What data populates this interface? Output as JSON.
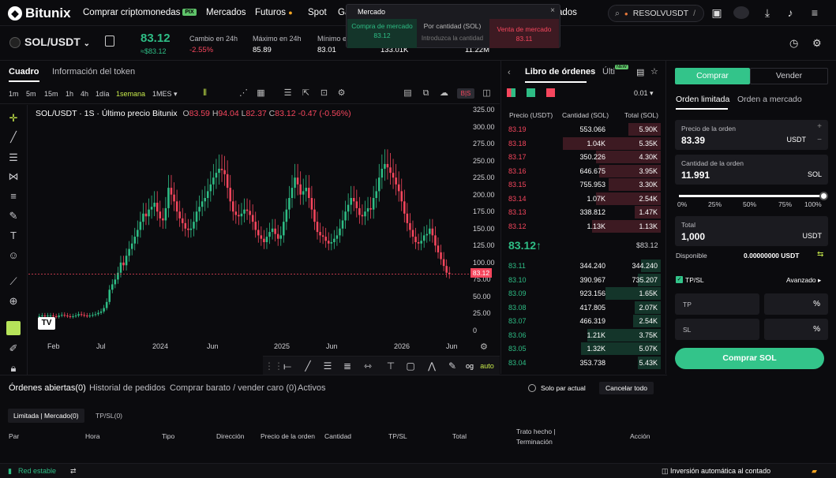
{
  "nav": {
    "brand": "Bitunix",
    "items": [
      {
        "label": "Comprar criptomonedas",
        "badge": "PIX"
      },
      {
        "label": "Mercados"
      },
      {
        "label": "Futuros"
      },
      {
        "label": "Spot"
      },
      {
        "label": "Ga"
      },
      {
        "label": "ados"
      }
    ],
    "search_value": "RESOLVUSDT",
    "search_suffix": "/"
  },
  "popup": {
    "title": "Mercado",
    "close": "×",
    "buy_label": "Compra de mercado",
    "buy_value": "83.12",
    "qty_label": "Por cantidad (SOL)",
    "qty_placeholder": "Introduzca la cantidad",
    "sell_label": "Venta de mercado",
    "sell_value": "83.11"
  },
  "ticker": {
    "pair": "SOL/USDT",
    "price": "83.12",
    "price_fiat": "≈$83.12",
    "change_label": "Cambio en 24h",
    "change_value": "-2.55%",
    "high_label": "Máximo en 24h",
    "high_value": "85.89",
    "low_label": "Mínimo e",
    "low_value": "83.01",
    "vol1_value": "133.01K",
    "vol2_value": "11.22M"
  },
  "chart_tabs": {
    "active": "Cuadro",
    "other": "Información del token"
  },
  "timeframes": [
    "1m",
    "5m",
    "15m",
    "1h",
    "4h",
    "1día",
    "1semana",
    "1MES"
  ],
  "active_timeframe": "1semana",
  "chart_legend": {
    "title": "SOL/USDT · 1S · Último precio Bitunix",
    "o_label": "O",
    "o": "83.59",
    "h_label": "H",
    "h": "94.04",
    "l_label": "L",
    "l": "82.37",
    "c_label": "C",
    "c": "83.12",
    "chg": "-0.47 (-0.56%)"
  },
  "chart_data": {
    "type": "candlestick",
    "y_ticks": [
      "325.00",
      "300.00",
      "275.00",
      "250.00",
      "225.00",
      "200.00",
      "175.00",
      "150.00",
      "125.00",
      "100.00",
      "75.00",
      "50.00",
      "25.00",
      "0"
    ],
    "x_ticks": [
      "Feb",
      "Jul",
      "2024",
      "Jun",
      "2025",
      "Jun",
      "2026",
      "Jun"
    ],
    "ylim": [
      0,
      325
    ],
    "last_price": "83.12",
    "close_series": [
      21,
      22,
      21,
      22,
      22,
      21,
      20,
      22,
      23,
      22,
      21,
      20,
      21,
      22,
      24,
      23,
      22,
      21,
      22,
      23,
      24,
      26,
      28,
      33,
      42,
      60,
      68,
      75,
      85,
      100,
      96,
      110,
      120,
      128,
      138,
      148,
      160,
      172,
      168,
      178,
      182,
      188,
      175,
      165,
      162,
      180,
      210,
      200,
      190,
      175,
      165,
      158,
      150,
      148,
      150,
      160,
      175,
      182,
      190,
      195,
      205,
      215,
      225,
      232,
      238,
      236,
      230,
      210,
      190,
      175,
      170,
      168,
      172,
      178,
      176,
      170,
      160,
      148,
      140,
      135,
      130,
      138,
      145,
      150,
      142,
      135,
      140,
      160,
      178,
      195,
      210,
      225,
      215,
      200,
      205,
      210,
      195,
      178,
      160,
      145,
      140,
      138,
      132,
      128,
      130,
      135,
      140,
      150,
      162,
      175,
      185,
      195,
      190,
      180,
      170,
      168,
      175,
      180,
      178,
      195,
      205,
      225,
      238,
      245,
      240,
      232,
      225,
      215,
      205,
      190,
      172,
      158,
      148,
      138,
      130,
      128,
      132,
      140,
      142,
      150,
      140,
      125,
      115,
      105,
      95,
      85,
      83
    ]
  },
  "orderbook": {
    "tab_active": "Libro de órdenes",
    "tab_other": "Últi",
    "tab_badge": "NEW",
    "precision": "0.01",
    "headers": [
      "Precio (USDT)",
      "Cantidad (SOL)",
      "Total (SOL)"
    ],
    "asks": [
      {
        "p": "83.19",
        "q": "553.066",
        "t": "5.90K",
        "d": 0.2
      },
      {
        "p": "83.18",
        "q": "1.04K",
        "t": "5.35K",
        "d": 0.38
      },
      {
        "p": "83.17",
        "q": "350.226",
        "t": "4.30K",
        "d": 0.13
      },
      {
        "p": "83.16",
        "q": "646.675",
        "t": "3.95K",
        "d": 0.24
      },
      {
        "p": "83.15",
        "q": "755.953",
        "t": "3.30K",
        "d": 0.28
      },
      {
        "p": "83.14",
        "q": "1.07K",
        "t": "2.54K",
        "d": 0.4
      },
      {
        "p": "83.13",
        "q": "338.812",
        "t": "1.47K",
        "d": 0.13
      },
      {
        "p": "83.12",
        "q": "1.13K",
        "t": "1.13K",
        "d": 0.42
      }
    ],
    "mid_price": "83.12",
    "mid_arrow": "↑",
    "mid_fiat": "$83.12",
    "bids": [
      {
        "p": "83.11",
        "q": "344.240",
        "t": "344.240",
        "d": 0.12
      },
      {
        "p": "83.10",
        "q": "390.967",
        "t": "735.207",
        "d": 0.14
      },
      {
        "p": "83.09",
        "q": "923.156",
        "t": "1.65K",
        "d": 0.34
      },
      {
        "p": "83.08",
        "q": "417.805",
        "t": "2.07K",
        "d": 0.15
      },
      {
        "p": "83.07",
        "q": "466.319",
        "t": "2.54K",
        "d": 0.17
      },
      {
        "p": "83.06",
        "q": "1.21K",
        "t": "3.75K",
        "d": 0.45
      },
      {
        "p": "83.05",
        "q": "1.32K",
        "t": "5.07K",
        "d": 0.49
      },
      {
        "p": "83.04",
        "q": "353.738",
        "t": "5.43K",
        "d": 0.13
      }
    ]
  },
  "trade": {
    "buy_tab": "Comprar",
    "sell_tab": "Vender",
    "type_active": "Orden limitada",
    "type_other": "Orden a mercado",
    "price_label": "Precio de la orden",
    "price_value": "83.39",
    "price_unit": "USDT",
    "qty_label": "Cantidad de la orden",
    "qty_value": "11.991",
    "qty_unit": "SOL",
    "slider_pct": 1.0,
    "slider_marks": [
      "0%",
      "25%",
      "50%",
      "75%",
      "100%"
    ],
    "total_label": "Total",
    "total_value": "1,000",
    "total_unit": "USDT",
    "available_label": "Disponible",
    "available_value": "0.00000000 USDT",
    "tpsl_label": "TP/SL",
    "advanced": "Avanzado",
    "tp_label": "TP",
    "sl_label": "SL",
    "pct": "%",
    "submit": "Comprar SOL"
  },
  "orders": {
    "tabs": [
      "Órdenes abiertas(0)",
      "Historial de pedidos",
      "Comprar barato / vender caro (0)",
      "Activos"
    ],
    "only_current": "Solo par actual",
    "cancel_all": "Cancelar todo",
    "subtabs": [
      "Limitada | Mercado(0)",
      "TP/SL(0)"
    ],
    "columns": [
      "Par",
      "Hora",
      "Tipo",
      "Dirección",
      "Precio de la orden",
      "Cantidad",
      "TP/SL",
      "Total",
      "Trato hecho |",
      "Terminación",
      "Acción"
    ]
  },
  "status": {
    "network": "Red estable",
    "auto_invest": "Inversión automática al contado"
  },
  "colors": {
    "green": "#2ebd85",
    "red": "#f6465d",
    "accent_green": "#33c48a",
    "bg": "#0b0b0e"
  }
}
